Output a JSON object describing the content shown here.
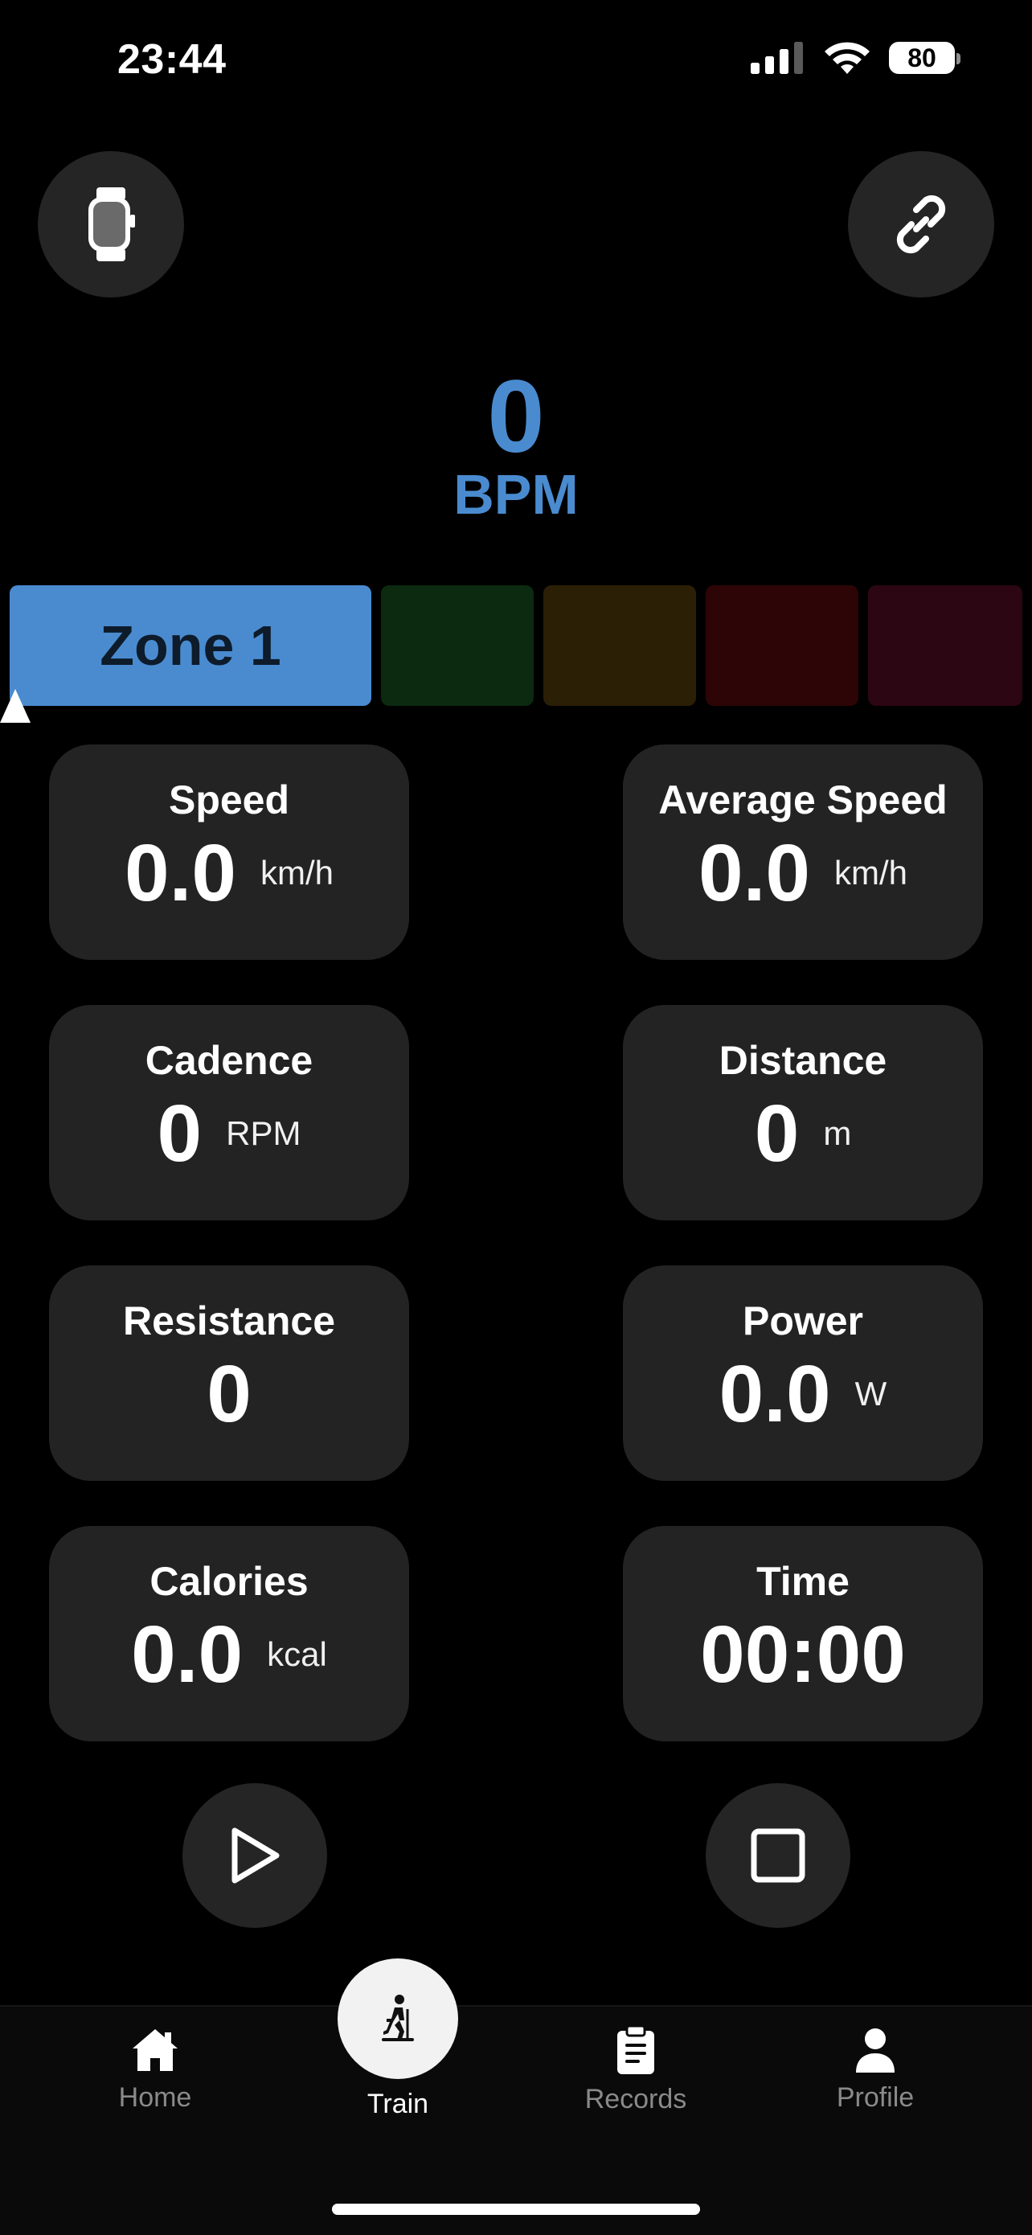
{
  "status_bar": {
    "time": "23:44",
    "battery": "80",
    "icons": [
      "signal-icon",
      "wifi-icon",
      "battery-icon"
    ]
  },
  "top_buttons": {
    "left_icon": "watch-icon",
    "right_icon": "link-icon"
  },
  "heart_rate": {
    "value": "0",
    "unit": "BPM",
    "color": "#4a8bd0"
  },
  "zones": {
    "active_label": "Zone 1",
    "colors": [
      "#4a8bd0",
      "#0c2a10",
      "#2b1f06",
      "#2d0506",
      "#2c0612"
    ]
  },
  "metrics": {
    "speed": {
      "label": "Speed",
      "value": "0.0",
      "unit": "km/h"
    },
    "average_speed": {
      "label": "Average Speed",
      "value": "0.0",
      "unit": "km/h"
    },
    "cadence": {
      "label": "Cadence",
      "value": "0",
      "unit": "RPM"
    },
    "distance": {
      "label": "Distance",
      "value": "0",
      "unit": "m"
    },
    "resistance": {
      "label": "Resistance",
      "value": "0"
    },
    "power": {
      "label": "Power",
      "value": "0.0",
      "unit": "W"
    },
    "calories": {
      "label": "Calories",
      "value": "0.0",
      "unit": "kcal"
    },
    "time": {
      "label": "Time",
      "value": "00:00"
    }
  },
  "controls": {
    "play_icon": "play-icon",
    "stop_icon": "stop-icon"
  },
  "tabbar": {
    "home": "Home",
    "train": "Train",
    "records": "Records",
    "profile": "Profile"
  }
}
